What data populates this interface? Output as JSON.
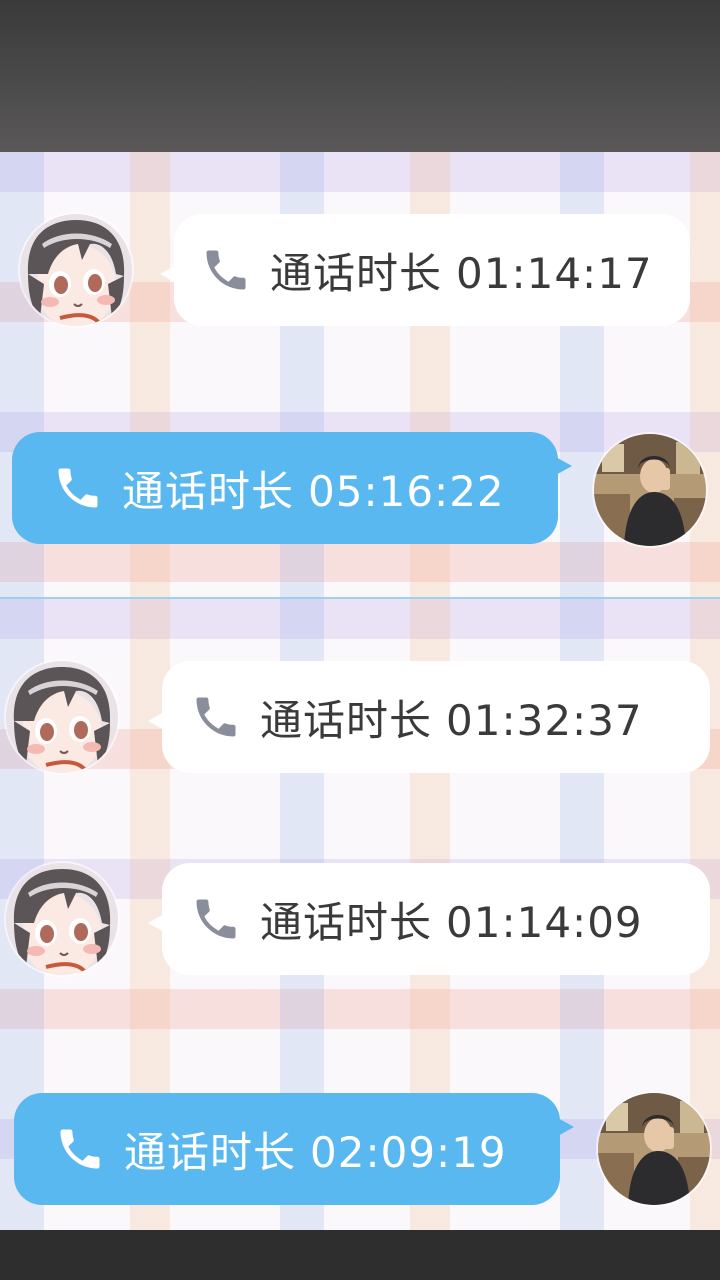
{
  "colors": {
    "incoming_bubble": "#ffffff",
    "outgoing_bubble": "#5ab8f0",
    "incoming_icon": "#8a8e9c",
    "outgoing_icon": "#ffffff"
  },
  "panels": [
    {
      "messages": [
        {
          "side": "left",
          "icon": "phone-icon",
          "label": "通话时长",
          "duration": "01:14:17"
        },
        {
          "side": "right",
          "icon": "phone-icon",
          "label": "通话时长",
          "duration": "05:16:22"
        }
      ]
    },
    {
      "messages": [
        {
          "side": "left",
          "icon": "phone-icon",
          "label": "通话时长",
          "duration": "01:32:37"
        },
        {
          "side": "left",
          "icon": "phone-icon",
          "label": "通话时长",
          "duration": "01:14:09"
        },
        {
          "side": "right",
          "icon": "phone-icon",
          "label": "通话时长",
          "duration": "02:09:19"
        }
      ]
    }
  ]
}
